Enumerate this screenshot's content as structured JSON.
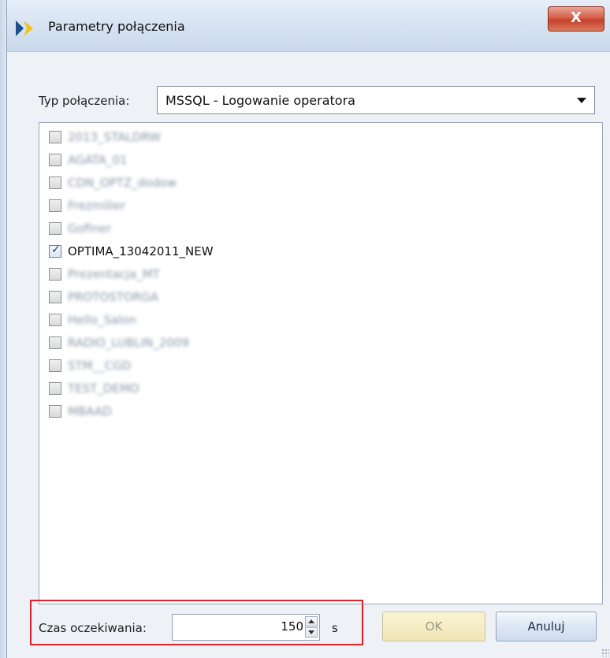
{
  "window": {
    "title": "Parametry połączenia",
    "close_label": "X"
  },
  "connection_type": {
    "label": "Typ połączenia:",
    "selected": "MSSQL - Logowanie operatora"
  },
  "databases": [
    {
      "name": "2013_STALDRW",
      "checked": false,
      "blurred": true
    },
    {
      "name": "AGATA_01",
      "checked": false,
      "blurred": true
    },
    {
      "name": "CDN_OPTZ_dodow",
      "checked": false,
      "blurred": true
    },
    {
      "name": "Frezmiller",
      "checked": false,
      "blurred": true
    },
    {
      "name": "Gofiner",
      "checked": false,
      "blurred": true
    },
    {
      "name": "OPTIMA_13042011_NEW",
      "checked": true,
      "blurred": false
    },
    {
      "name": "Prezentacja_MT",
      "checked": false,
      "blurred": true
    },
    {
      "name": "PROTOSTORGA",
      "checked": false,
      "blurred": true
    },
    {
      "name": "Hello_Salon",
      "checked": false,
      "blurred": true
    },
    {
      "name": "RADIO_LUBLIN_2009",
      "checked": false,
      "blurred": true
    },
    {
      "name": "STM__CGD",
      "checked": false,
      "blurred": true
    },
    {
      "name": "TEST_DEMO",
      "checked": false,
      "blurred": true
    },
    {
      "name": "MBAAD",
      "checked": false,
      "blurred": true
    }
  ],
  "timeout": {
    "label": "Czas oczekiwania:",
    "value": "150",
    "unit": "s"
  },
  "buttons": {
    "ok": "OK",
    "cancel": "Anuluj"
  },
  "colors": {
    "highlight_border": "#e0202a",
    "ok_button": "#f5eec8",
    "titlebar": "#d6e2f1"
  }
}
